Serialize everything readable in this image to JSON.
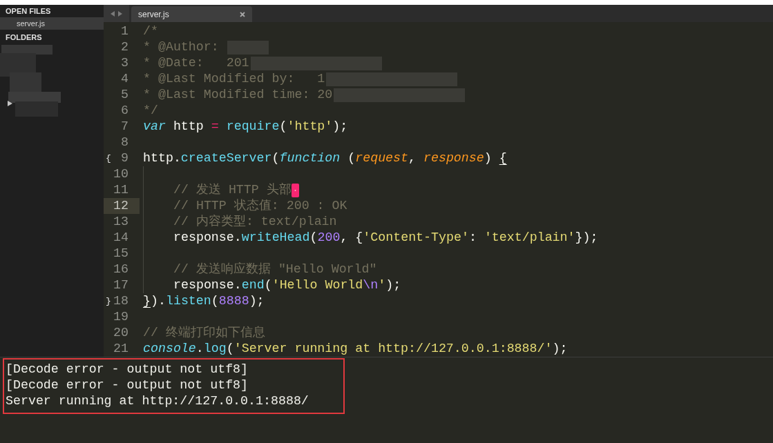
{
  "sidebar": {
    "open_files_heading": "OPEN FILES",
    "open_files": [
      {
        "label": "server.js",
        "selected": true
      }
    ],
    "folders_heading": "FOLDERS"
  },
  "tabs": [
    {
      "label": "server.js",
      "selected": true
    }
  ],
  "editor": {
    "lines": [
      {
        "number": "1",
        "current": false,
        "tokens": [
          {
            "kind": "comment",
            "text": "/*"
          }
        ]
      },
      {
        "number": "2",
        "current": false,
        "tokens": [
          {
            "kind": "comment",
            "text": "* @Author:"
          },
          {
            "kind": "blur_short"
          }
        ]
      },
      {
        "number": "3",
        "current": false,
        "tokens": [
          {
            "kind": "comment",
            "text": "* @Date:   201"
          },
          {
            "kind": "blur_long"
          }
        ]
      },
      {
        "number": "4",
        "current": false,
        "tokens": [
          {
            "kind": "comment",
            "text": "* @Last Modified by:   1"
          },
          {
            "kind": "blur_long"
          }
        ]
      },
      {
        "number": "5",
        "current": false,
        "tokens": [
          {
            "kind": "comment",
            "text": "* @Last Modified time: 20"
          },
          {
            "kind": "blur_long"
          }
        ]
      },
      {
        "number": "6",
        "current": false,
        "tokens": [
          {
            "kind": "comment",
            "text": "*/"
          }
        ]
      },
      {
        "number": "7",
        "current": false,
        "tokens": [
          {
            "kind": "keyword",
            "text": "var"
          },
          {
            "kind": "plain",
            "text": " http "
          },
          {
            "kind": "operator",
            "text": "= "
          },
          {
            "kind": "function",
            "text": "require"
          },
          {
            "kind": "plain",
            "text": "("
          },
          {
            "kind": "string",
            "text": "'http'"
          },
          {
            "kind": "plain",
            "text": ");"
          }
        ]
      },
      {
        "number": "8",
        "current": false
      },
      {
        "number": "9",
        "current": false,
        "fold_mark": "{",
        "tokens": [
          {
            "kind": "plain",
            "text": "http."
          },
          {
            "kind": "function",
            "text": "createServer"
          },
          {
            "kind": "plain",
            "text": "("
          },
          {
            "kind": "keyword",
            "text": "function"
          },
          {
            "kind": "plain",
            "text": " ("
          },
          {
            "kind": "param",
            "text": "request"
          },
          {
            "kind": "plain",
            "text": ", "
          },
          {
            "kind": "param",
            "text": "response"
          },
          {
            "kind": "plain",
            "text": ") "
          },
          {
            "kind": "bracket_match",
            "text": "{"
          }
        ],
        "children": [
          {
            "number": "10",
            "current": false
          },
          {
            "number": "11",
            "current": false,
            "tokens": [
              {
                "kind": "comment",
                "text": "// 发送 HTTP 头部"
              },
              {
                "kind": "invalid"
              }
            ]
          },
          {
            "number": "12",
            "current": true,
            "tokens": [
              {
                "kind": "comment",
                "text": "// HTTP 状态值: 200 : OK"
              }
            ]
          },
          {
            "number": "13",
            "current": false,
            "tokens": [
              {
                "kind": "comment",
                "text": "// 内容类型: text/plain"
              }
            ]
          },
          {
            "number": "14",
            "current": false,
            "tokens": [
              {
                "kind": "plain",
                "text": "response."
              },
              {
                "kind": "function",
                "text": "writeHead"
              },
              {
                "kind": "plain",
                "text": "("
              },
              {
                "kind": "number",
                "text": "200"
              },
              {
                "kind": "plain",
                "text": ", {"
              },
              {
                "kind": "string",
                "text": "'Content-Type'"
              },
              {
                "kind": "plain",
                "text": ": "
              },
              {
                "kind": "string",
                "text": "'text/plain'"
              },
              {
                "kind": "plain",
                "text": "});"
              }
            ]
          },
          {
            "number": "15",
            "current": false
          },
          {
            "number": "16",
            "current": false,
            "tokens": [
              {
                "kind": "comment",
                "text": "// 发送响应数据 \"Hello World\""
              }
            ]
          },
          {
            "number": "17",
            "current": false,
            "tokens": [
              {
                "kind": "plain",
                "text": "response."
              },
              {
                "kind": "function",
                "text": "end"
              },
              {
                "kind": "plain",
                "text": "("
              },
              {
                "kind": "string",
                "text": "'Hello World"
              },
              {
                "kind": "escape",
                "text": "\\n"
              },
              {
                "kind": "string",
                "text": "'"
              },
              {
                "kind": "plain",
                "text": ");"
              }
            ]
          }
        ]
      },
      {
        "number": "18",
        "current": false,
        "fold_mark": "}",
        "tokens": [
          {
            "kind": "bracket_match",
            "text": "}"
          },
          {
            "kind": "plain",
            "text": ")."
          },
          {
            "kind": "function",
            "text": "listen"
          },
          {
            "kind": "plain",
            "text": "("
          },
          {
            "kind": "number",
            "text": "8888"
          },
          {
            "kind": "plain",
            "text": ");"
          }
        ]
      },
      {
        "number": "19",
        "current": false
      },
      {
        "number": "20",
        "current": false,
        "tokens": [
          {
            "kind": "comment",
            "text": "// 终端打印如下信息"
          }
        ]
      },
      {
        "number": "21",
        "current": false,
        "tokens": [
          {
            "kind": "keyword",
            "text": "console"
          },
          {
            "kind": "plain",
            "text": "."
          },
          {
            "kind": "function",
            "text": "log"
          },
          {
            "kind": "plain",
            "text": "("
          },
          {
            "kind": "string",
            "text": "'Server running at http://127.0.0.1:8888/'"
          },
          {
            "kind": "plain",
            "text": ");"
          }
        ]
      }
    ]
  },
  "output": {
    "highlighted": true,
    "lines": [
      "[Decode error - output not utf8]",
      "[Decode error - output not utf8]",
      "Server running at http://127.0.0.1:8888/"
    ]
  }
}
